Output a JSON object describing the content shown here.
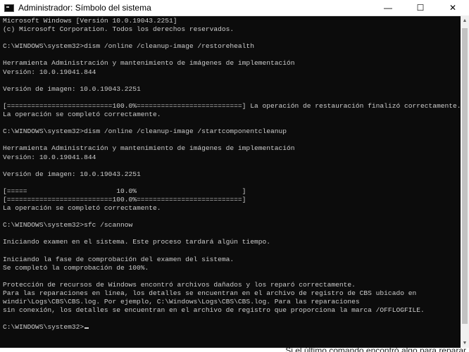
{
  "window": {
    "title": "Administrador: Símbolo del sistema",
    "controls": {
      "minimize": "—",
      "maximize": "☐",
      "close": "✕"
    }
  },
  "console": {
    "lines": [
      "Microsoft Windows [Versión 10.0.19043.2251]",
      "(c) Microsoft Corporation. Todos los derechos reservados.",
      "",
      "C:\\WINDOWS\\system32>dism /online /cleanup-image /restorehealth",
      "",
      "Herramienta Administración y mantenimiento de imágenes de implementación",
      "Versión: 10.0.19041.844",
      "",
      "Versión de imagen: 10.0.19043.2251",
      "",
      "[==========================100.0%==========================] La operación de restauración finalizó correctamente.",
      "La operación se completó correctamente.",
      "",
      "C:\\WINDOWS\\system32>dism /online /cleanup-image /startcomponentcleanup",
      "",
      "Herramienta Administración y mantenimiento de imágenes de implementación",
      "Versión: 10.0.19041.844",
      "",
      "Versión de imagen: 10.0.19043.2251",
      "",
      "[=====                      10.0%                          ]",
      "[==========================100.0%==========================]",
      "La operación se completó correctamente.",
      "",
      "C:\\WINDOWS\\system32>sfc /scannow",
      "",
      "Iniciando examen en el sistema. Este proceso tardará algún tiempo.",
      "",
      "Iniciando la fase de comprobación del examen del sistema.",
      "Se completó la comprobación de 100%.",
      "",
      "Protección de recursos de Windows encontró archivos dañados y los reparó correctamente.",
      "Para las reparaciones en línea, los detalles se encuentran en el archivo de registro de CBS ubicado en",
      "windir\\Logs\\CBS\\CBS.log. Por ejemplo, C:\\Windows\\Logs\\CBS\\CBS.log. Para las reparaciones",
      "sin conexión, los detalles se encuentran en el archivo de registro que proporciona la marca /OFFLOGFILE.",
      "",
      "C:\\WINDOWS\\system32>"
    ]
  },
  "background": {
    "partial_text": "Si el último comando encontró algo para reparar"
  }
}
